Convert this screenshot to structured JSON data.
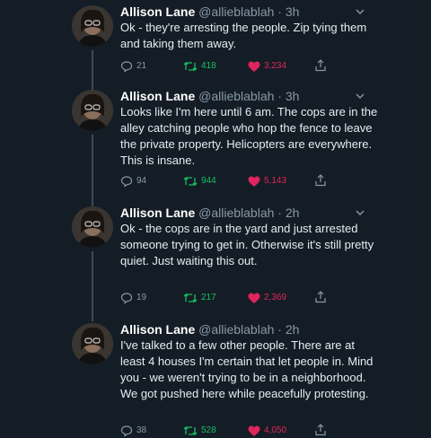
{
  "tweets": [
    {
      "name": "Allison Lane",
      "handle": "@allieblablah",
      "time": "3h",
      "text": "Ok - they're arresting the people. Zip tying them and taking them away.",
      "replies": "21",
      "retweets": "418",
      "likes": "3,234"
    },
    {
      "name": "Allison Lane",
      "handle": "@allieblablah",
      "time": "3h",
      "text": "Looks like I'm here until 6 am. The cops are in the alley catching people who hop the fence to leave the private property. Helicopters are everywhere. This is insane.",
      "replies": "94",
      "retweets": "944",
      "likes": "5,143"
    },
    {
      "name": "Allison Lane",
      "handle": "@allieblablah",
      "time": "2h",
      "text": "Ok - the cops are in the yard and just arrested someone trying to get in. Otherwise it's still pretty quiet. Just waiting this out.",
      "replies": "19",
      "retweets": "217",
      "likes": "2,369"
    },
    {
      "name": "Allison Lane",
      "handle": "@allieblablah",
      "time": "2h",
      "text": "I've talked to a few other people. There are at least 4 houses I'm certain that let people in. Mind you - we weren't trying to be in a neighborhood. We got pushed here while peacefully protesting.",
      "replies": "38",
      "retweets": "528",
      "likes": "4,050"
    }
  ],
  "separator": " · ",
  "colors": {
    "background": "#141d26",
    "name": "#ffffff",
    "muted": "#8899a6",
    "retweet": "#17bf63",
    "like": "#e0245e"
  },
  "icons": {
    "reply": "reply-icon",
    "retweet": "retweet-icon",
    "like": "heart-icon",
    "share": "share-icon",
    "menu": "chevron-down-icon"
  }
}
